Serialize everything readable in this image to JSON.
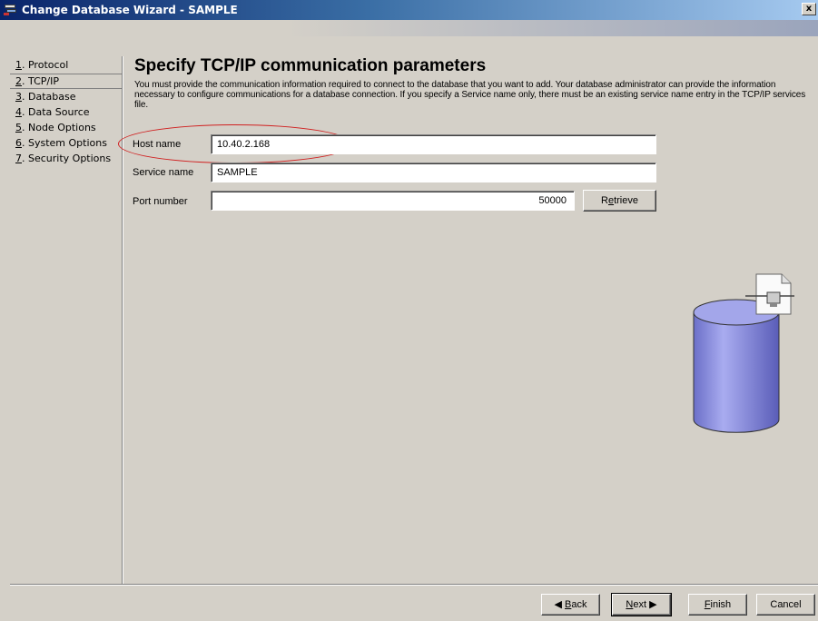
{
  "window": {
    "title": "Change Database Wizard - SAMPLE",
    "close_label": "x"
  },
  "nav": {
    "items": [
      {
        "num": "1",
        "label": ". Protocol"
      },
      {
        "num": "2",
        "label": ". TCP/IP"
      },
      {
        "num": "3",
        "label": ". Database"
      },
      {
        "num": "4",
        "label": ". Data Source"
      },
      {
        "num": "5",
        "label": ". Node Options"
      },
      {
        "num": "6",
        "label": ". System Options"
      },
      {
        "num": "7",
        "label": ". Security Options"
      }
    ],
    "active_index": 1
  },
  "content": {
    "heading": "Specify TCP/IP communication parameters",
    "description": "You must provide the communication information required to connect to the database that you want to add. Your database administrator can provide the information necessary to configure communications for a database connection. If you specify a Service name only, there must be an existing service name entry in the TCP/IP services file.",
    "host_name_label": "Host name",
    "host_name_value": "10.40.2.168",
    "service_name_label": "Service name",
    "service_name_value": "SAMPLE",
    "port_number_label": "Port number",
    "port_number_value": "50000",
    "retrieve_label": "Retrieve"
  },
  "footer": {
    "back_label": "Back",
    "next_label": "Next",
    "finish_label": "Finish",
    "cancel_label": "Cancel"
  },
  "colors": {
    "titlebar_start": "#0a246a",
    "window_bg": "#d4d0c8",
    "highlight_ellipse": "#d02020",
    "cylinder": "#8b8fe0"
  }
}
